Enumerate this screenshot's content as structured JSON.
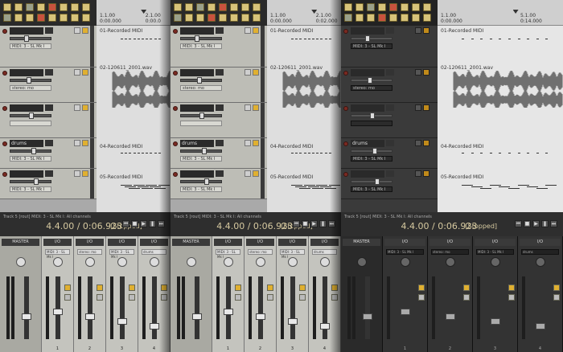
{
  "panels": [
    {
      "theme": "light",
      "ruler": {
        "pos": "1.1.00",
        "time": "0:00.000",
        "pos2": "2.1.00",
        "time2": "0:00.0"
      },
      "items": [
        "01-Recorded MIDI",
        "02-120611_2001.wav",
        "04-Recorded MIDI",
        "05-Recorded MIDI"
      ],
      "track_names": [
        "",
        "",
        "",
        "drums",
        ""
      ],
      "routes": [
        "MIDI: 3 - SL Mk I",
        "stereo: mo",
        "",
        "MIDI: 3 - SL Mk I",
        "MIDI: 3 - SL Mk I"
      ],
      "status": "Track 5 [rout] MIDI: 3 - SL Mk I: All channels",
      "time": "4.4.00 / 0:06.923",
      "state": "[Stopped]",
      "master": "MASTER",
      "strip_labels": [
        "MIDI: 3 - SL Mk I",
        "stereo: mo",
        "MIDI: 3 - SL Mk I",
        "drums"
      ],
      "strip_nums": [
        "1",
        "2",
        "3",
        "4"
      ],
      "io": "I/O"
    },
    {
      "theme": "light",
      "ruler": {
        "pos": "1.1.00",
        "time": "0:00.000",
        "pos2": "2.1.00",
        "time2": "0:02.000"
      },
      "items": [
        "01-Recorded MIDI",
        "02-120611_2001.wav",
        "04-Recorded MIDI",
        "05-Recorded MIDI"
      ],
      "track_names": [
        "",
        "",
        "",
        "drums",
        ""
      ],
      "routes": [
        "MIDI: 3 - SL Mk I",
        "stereo: mo",
        "",
        "MIDI: 3 - SL Mk I",
        "MIDI: 3 - SL Mk I"
      ],
      "status": "Track 5 [rout] MIDI: 3 - SL Mk I: All channels",
      "time": "4.4.00 / 0:06.923",
      "state": "[Stopped]",
      "master": "MASTER",
      "strip_labels": [
        "MIDI: 3 - SL Mk I",
        "stereo: mo",
        "MIDI: 3 - SL Mk I",
        "drums"
      ],
      "strip_nums": [
        "1",
        "2",
        "3",
        "4"
      ],
      "io": "I/O"
    },
    {
      "theme": "dark",
      "ruler": {
        "pos": "1.1.00",
        "time": "0:00.000",
        "pos2": "5.1.00",
        "time2": "0:14.000"
      },
      "items": [
        "01-Recorded MIDI",
        "02-120611_2001.wav",
        "04-Recorded MIDI",
        "05-Recorded MIDI"
      ],
      "track_names": [
        "",
        "",
        "",
        "drums",
        ""
      ],
      "routes": [
        "MIDI: 3 - SL Mk I",
        "stereo: mo",
        "",
        "MIDI: 3 - SL Mk I",
        "MIDI: 3 - SL Mk I"
      ],
      "status": "Track 5 [rout] MIDI: 3 - SL Mk I: All channels",
      "time": "4.4.00 / 0:06.923",
      "state": "[Stopped]",
      "master": "MASTER",
      "strip_labels": [
        "MIDI: 3 - SL Mk I",
        "stereo: mo",
        "MIDI: 3 - SL Mk I",
        "drums"
      ],
      "strip_nums": [
        "1",
        "2",
        "3",
        "4"
      ],
      "io": "I/O"
    }
  ],
  "colors": {
    "accent": "#e0b030",
    "record": "#c9523d",
    "time": "#d6c9a0"
  },
  "icons": [
    "record-arm-icon",
    "play-icon",
    "stop-icon",
    "rewind-icon",
    "fast-forward-icon",
    "loop-icon",
    "record-icon"
  ]
}
